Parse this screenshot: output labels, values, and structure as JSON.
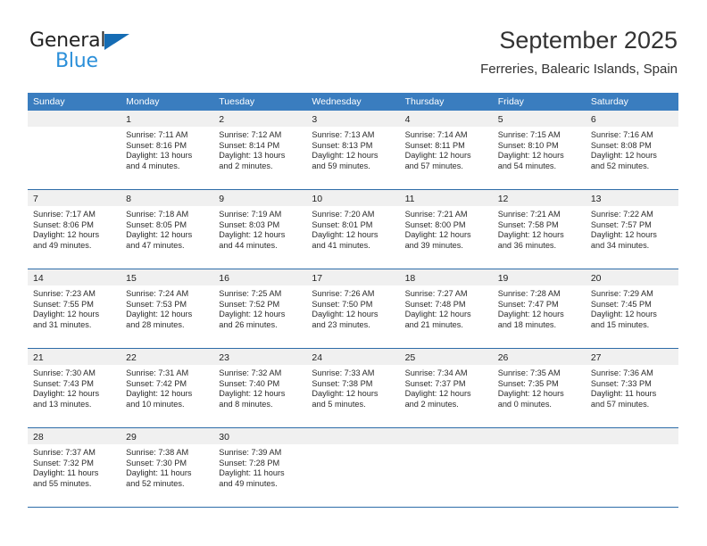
{
  "brand": {
    "name_part1": "General",
    "name_part2": "Blue",
    "triangle_icon": "triangle-icon",
    "color_dark": "#222222",
    "color_blue": "#2b8fd9",
    "color_triangle": "#156cb4"
  },
  "header": {
    "title": "September 2025",
    "subtitle": "Ferreries, Balearic Islands, Spain"
  },
  "theme": {
    "header_bg": "#3a7dbf",
    "header_text": "#ffffff",
    "rule_color": "#2d6ca8",
    "day_band_bg": "#f0f0f0"
  },
  "weekdays": [
    "Sunday",
    "Monday",
    "Tuesday",
    "Wednesday",
    "Thursday",
    "Friday",
    "Saturday"
  ],
  "weeks": [
    [
      {
        "day": "",
        "sunrise": "",
        "sunset": "",
        "daylight_line1": "",
        "daylight_line2": "",
        "empty": true
      },
      {
        "day": "1",
        "sunrise": "Sunrise: 7:11 AM",
        "sunset": "Sunset: 8:16 PM",
        "daylight_line1": "Daylight: 13 hours",
        "daylight_line2": "and 4 minutes.",
        "empty": false
      },
      {
        "day": "2",
        "sunrise": "Sunrise: 7:12 AM",
        "sunset": "Sunset: 8:14 PM",
        "daylight_line1": "Daylight: 13 hours",
        "daylight_line2": "and 2 minutes.",
        "empty": false
      },
      {
        "day": "3",
        "sunrise": "Sunrise: 7:13 AM",
        "sunset": "Sunset: 8:13 PM",
        "daylight_line1": "Daylight: 12 hours",
        "daylight_line2": "and 59 minutes.",
        "empty": false
      },
      {
        "day": "4",
        "sunrise": "Sunrise: 7:14 AM",
        "sunset": "Sunset: 8:11 PM",
        "daylight_line1": "Daylight: 12 hours",
        "daylight_line2": "and 57 minutes.",
        "empty": false
      },
      {
        "day": "5",
        "sunrise": "Sunrise: 7:15 AM",
        "sunset": "Sunset: 8:10 PM",
        "daylight_line1": "Daylight: 12 hours",
        "daylight_line2": "and 54 minutes.",
        "empty": false
      },
      {
        "day": "6",
        "sunrise": "Sunrise: 7:16 AM",
        "sunset": "Sunset: 8:08 PM",
        "daylight_line1": "Daylight: 12 hours",
        "daylight_line2": "and 52 minutes.",
        "empty": false
      }
    ],
    [
      {
        "day": "7",
        "sunrise": "Sunrise: 7:17 AM",
        "sunset": "Sunset: 8:06 PM",
        "daylight_line1": "Daylight: 12 hours",
        "daylight_line2": "and 49 minutes.",
        "empty": false
      },
      {
        "day": "8",
        "sunrise": "Sunrise: 7:18 AM",
        "sunset": "Sunset: 8:05 PM",
        "daylight_line1": "Daylight: 12 hours",
        "daylight_line2": "and 47 minutes.",
        "empty": false
      },
      {
        "day": "9",
        "sunrise": "Sunrise: 7:19 AM",
        "sunset": "Sunset: 8:03 PM",
        "daylight_line1": "Daylight: 12 hours",
        "daylight_line2": "and 44 minutes.",
        "empty": false
      },
      {
        "day": "10",
        "sunrise": "Sunrise: 7:20 AM",
        "sunset": "Sunset: 8:01 PM",
        "daylight_line1": "Daylight: 12 hours",
        "daylight_line2": "and 41 minutes.",
        "empty": false
      },
      {
        "day": "11",
        "sunrise": "Sunrise: 7:21 AM",
        "sunset": "Sunset: 8:00 PM",
        "daylight_line1": "Daylight: 12 hours",
        "daylight_line2": "and 39 minutes.",
        "empty": false
      },
      {
        "day": "12",
        "sunrise": "Sunrise: 7:21 AM",
        "sunset": "Sunset: 7:58 PM",
        "daylight_line1": "Daylight: 12 hours",
        "daylight_line2": "and 36 minutes.",
        "empty": false
      },
      {
        "day": "13",
        "sunrise": "Sunrise: 7:22 AM",
        "sunset": "Sunset: 7:57 PM",
        "daylight_line1": "Daylight: 12 hours",
        "daylight_line2": "and 34 minutes.",
        "empty": false
      }
    ],
    [
      {
        "day": "14",
        "sunrise": "Sunrise: 7:23 AM",
        "sunset": "Sunset: 7:55 PM",
        "daylight_line1": "Daylight: 12 hours",
        "daylight_line2": "and 31 minutes.",
        "empty": false
      },
      {
        "day": "15",
        "sunrise": "Sunrise: 7:24 AM",
        "sunset": "Sunset: 7:53 PM",
        "daylight_line1": "Daylight: 12 hours",
        "daylight_line2": "and 28 minutes.",
        "empty": false
      },
      {
        "day": "16",
        "sunrise": "Sunrise: 7:25 AM",
        "sunset": "Sunset: 7:52 PM",
        "daylight_line1": "Daylight: 12 hours",
        "daylight_line2": "and 26 minutes.",
        "empty": false
      },
      {
        "day": "17",
        "sunrise": "Sunrise: 7:26 AM",
        "sunset": "Sunset: 7:50 PM",
        "daylight_line1": "Daylight: 12 hours",
        "daylight_line2": "and 23 minutes.",
        "empty": false
      },
      {
        "day": "18",
        "sunrise": "Sunrise: 7:27 AM",
        "sunset": "Sunset: 7:48 PM",
        "daylight_line1": "Daylight: 12 hours",
        "daylight_line2": "and 21 minutes.",
        "empty": false
      },
      {
        "day": "19",
        "sunrise": "Sunrise: 7:28 AM",
        "sunset": "Sunset: 7:47 PM",
        "daylight_line1": "Daylight: 12 hours",
        "daylight_line2": "and 18 minutes.",
        "empty": false
      },
      {
        "day": "20",
        "sunrise": "Sunrise: 7:29 AM",
        "sunset": "Sunset: 7:45 PM",
        "daylight_line1": "Daylight: 12 hours",
        "daylight_line2": "and 15 minutes.",
        "empty": false
      }
    ],
    [
      {
        "day": "21",
        "sunrise": "Sunrise: 7:30 AM",
        "sunset": "Sunset: 7:43 PM",
        "daylight_line1": "Daylight: 12 hours",
        "daylight_line2": "and 13 minutes.",
        "empty": false
      },
      {
        "day": "22",
        "sunrise": "Sunrise: 7:31 AM",
        "sunset": "Sunset: 7:42 PM",
        "daylight_line1": "Daylight: 12 hours",
        "daylight_line2": "and 10 minutes.",
        "empty": false
      },
      {
        "day": "23",
        "sunrise": "Sunrise: 7:32 AM",
        "sunset": "Sunset: 7:40 PM",
        "daylight_line1": "Daylight: 12 hours",
        "daylight_line2": "and 8 minutes.",
        "empty": false
      },
      {
        "day": "24",
        "sunrise": "Sunrise: 7:33 AM",
        "sunset": "Sunset: 7:38 PM",
        "daylight_line1": "Daylight: 12 hours",
        "daylight_line2": "and 5 minutes.",
        "empty": false
      },
      {
        "day": "25",
        "sunrise": "Sunrise: 7:34 AM",
        "sunset": "Sunset: 7:37 PM",
        "daylight_line1": "Daylight: 12 hours",
        "daylight_line2": "and 2 minutes.",
        "empty": false
      },
      {
        "day": "26",
        "sunrise": "Sunrise: 7:35 AM",
        "sunset": "Sunset: 7:35 PM",
        "daylight_line1": "Daylight: 12 hours",
        "daylight_line2": "and 0 minutes.",
        "empty": false
      },
      {
        "day": "27",
        "sunrise": "Sunrise: 7:36 AM",
        "sunset": "Sunset: 7:33 PM",
        "daylight_line1": "Daylight: 11 hours",
        "daylight_line2": "and 57 minutes.",
        "empty": false
      }
    ],
    [
      {
        "day": "28",
        "sunrise": "Sunrise: 7:37 AM",
        "sunset": "Sunset: 7:32 PM",
        "daylight_line1": "Daylight: 11 hours",
        "daylight_line2": "and 55 minutes.",
        "empty": false
      },
      {
        "day": "29",
        "sunrise": "Sunrise: 7:38 AM",
        "sunset": "Sunset: 7:30 PM",
        "daylight_line1": "Daylight: 11 hours",
        "daylight_line2": "and 52 minutes.",
        "empty": false
      },
      {
        "day": "30",
        "sunrise": "Sunrise: 7:39 AM",
        "sunset": "Sunset: 7:28 PM",
        "daylight_line1": "Daylight: 11 hours",
        "daylight_line2": "and 49 minutes.",
        "empty": false
      },
      {
        "day": "",
        "sunrise": "",
        "sunset": "",
        "daylight_line1": "",
        "daylight_line2": "",
        "empty": true
      },
      {
        "day": "",
        "sunrise": "",
        "sunset": "",
        "daylight_line1": "",
        "daylight_line2": "",
        "empty": true
      },
      {
        "day": "",
        "sunrise": "",
        "sunset": "",
        "daylight_line1": "",
        "daylight_line2": "",
        "empty": true
      },
      {
        "day": "",
        "sunrise": "",
        "sunset": "",
        "daylight_line1": "",
        "daylight_line2": "",
        "empty": true
      }
    ]
  ]
}
